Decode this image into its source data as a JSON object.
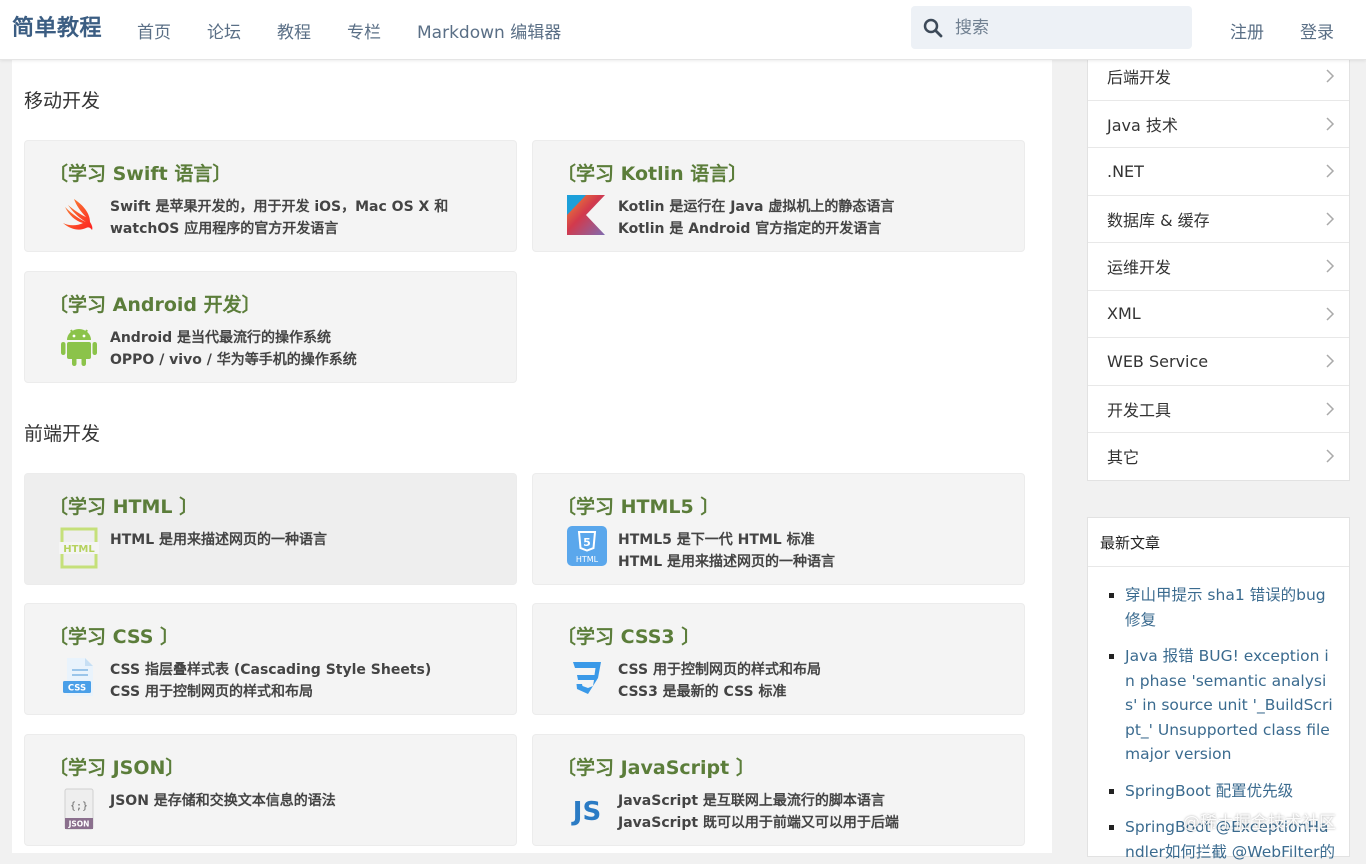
{
  "header": {
    "brand": "简单教程",
    "nav": [
      "首页",
      "论坛",
      "教程",
      "专栏",
      "Markdown 编辑器"
    ],
    "search_placeholder": "搜索",
    "register": "注册",
    "login": "登录"
  },
  "sections": [
    {
      "title": "移动开发",
      "cards": [
        {
          "title": "〔学习 Swift 语言〕",
          "icon": "swift-icon",
          "lines": [
            "Swift 是苹果开发的，用于开发 iOS，Mac OS X 和",
            "watchOS 应用程序的官方开发语言"
          ]
        },
        {
          "title": "〔学习 Kotlin 语言〕",
          "icon": "kotlin-icon",
          "lines": [
            "Kotlin 是运行在 Java 虚拟机上的静态语言",
            "Kotlin 是 Android 官方指定的开发语言"
          ]
        },
        {
          "title": "〔学习 Android 开发〕",
          "icon": "android-icon",
          "lines": [
            "Android 是当代最流行的操作系统",
            "OPPO / vivo / 华为等手机的操作系统"
          ]
        }
      ]
    },
    {
      "title": "前端开发",
      "cards": [
        {
          "title": "〔学习 HTML 〕",
          "icon": "html-icon",
          "lines": [
            "HTML 是用来描述网页的一种语言",
            ""
          ]
        },
        {
          "title": "〔学习 HTML5 〕",
          "icon": "html5-icon",
          "lines": [
            "HTML5 是下一代 HTML 标准",
            "HTML 是用来描述网页的一种语言"
          ]
        },
        {
          "title": "〔学习 CSS 〕",
          "icon": "css-icon",
          "lines": [
            "CSS 指层叠样式表 (Cascading Style Sheets)",
            "CSS 用于控制网页的样式和布局"
          ]
        },
        {
          "title": "〔学习 CSS3 〕",
          "icon": "css3-icon",
          "lines": [
            "CSS 用于控制网页的样式和布局",
            "CSS3 是最新的 CSS 标准"
          ]
        },
        {
          "title": "〔学习 JSON〕",
          "icon": "json-icon",
          "lines": [
            "JSON 是存储和交换文本信息的语法",
            ""
          ]
        },
        {
          "title": "〔学习 JavaScript 〕",
          "icon": "javascript-icon",
          "lines": [
            "JavaScript 是互联网上最流行的脚本语言",
            "JavaScript 既可以用于前端又可以用于后端"
          ]
        }
      ]
    }
  ],
  "sidebar": {
    "categories": [
      "后端开发",
      "Java 技术",
      ".NET",
      "数据库 & 缓存",
      "运维开发",
      "XML",
      "WEB Service",
      "开发工具",
      "其它"
    ],
    "latest_title": "最新文章",
    "latest": [
      "穿山甲提示 sha1 错误的bug修复",
      "Java 报错 BUG! exception in phase 'semantic analysis' in source unit '_BuildScript_' Unsupported class file major version",
      "SpringBoot 配置优先级",
      "SpringBoot @ExceptionHandler如何拦截 @WebFilter的"
    ]
  },
  "watermark": "@稀土掘金技术社区",
  "colors": {
    "brand": "#3b5d82",
    "card_title": "#5b7d3a",
    "link": "#3b6b8f"
  }
}
